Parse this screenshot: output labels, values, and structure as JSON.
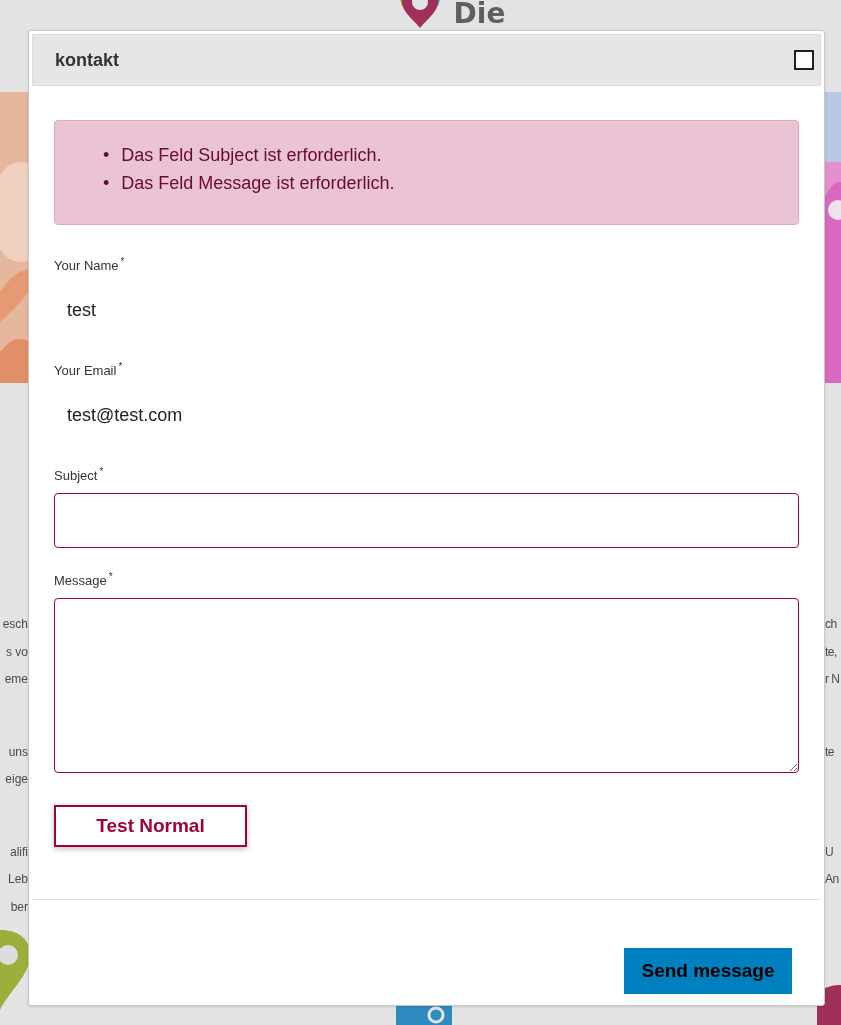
{
  "header": {
    "logo_text": "Die"
  },
  "background_paragraphs": [
    {
      "left": [
        "esch",
        "s vo",
        "eme"
      ],
      "right": [
        "ch",
        "te,",
        "r N"
      ]
    },
    {
      "left": [
        "uns",
        "eige"
      ],
      "right": [
        "te"
      ]
    },
    {
      "left": [
        "alifi",
        "Leb",
        "ber"
      ],
      "right": [
        "U",
        "An"
      ]
    }
  ],
  "dialog": {
    "title": "kontakt",
    "errors": [
      {
        "marker": "•",
        "text": "Das Feld Subject ist erforderlich."
      },
      {
        "marker": "•",
        "text": "Das Feld Message ist erforderlich."
      }
    ],
    "fields": [
      {
        "kind": "text",
        "label": "Your Name",
        "mark": "*",
        "value": "test",
        "invalid": false
      },
      {
        "kind": "text",
        "label": "Your Email",
        "mark": "*",
        "value": "test@test.com",
        "invalid": false
      },
      {
        "kind": "text",
        "label": "Subject",
        "mark": "*",
        "invalid": true
      },
      {
        "kind": "textarea",
        "label": "Message",
        "mark": "*",
        "invalid": true
      }
    ],
    "test_button": "Test Normal",
    "submit_button": "Send message"
  }
}
